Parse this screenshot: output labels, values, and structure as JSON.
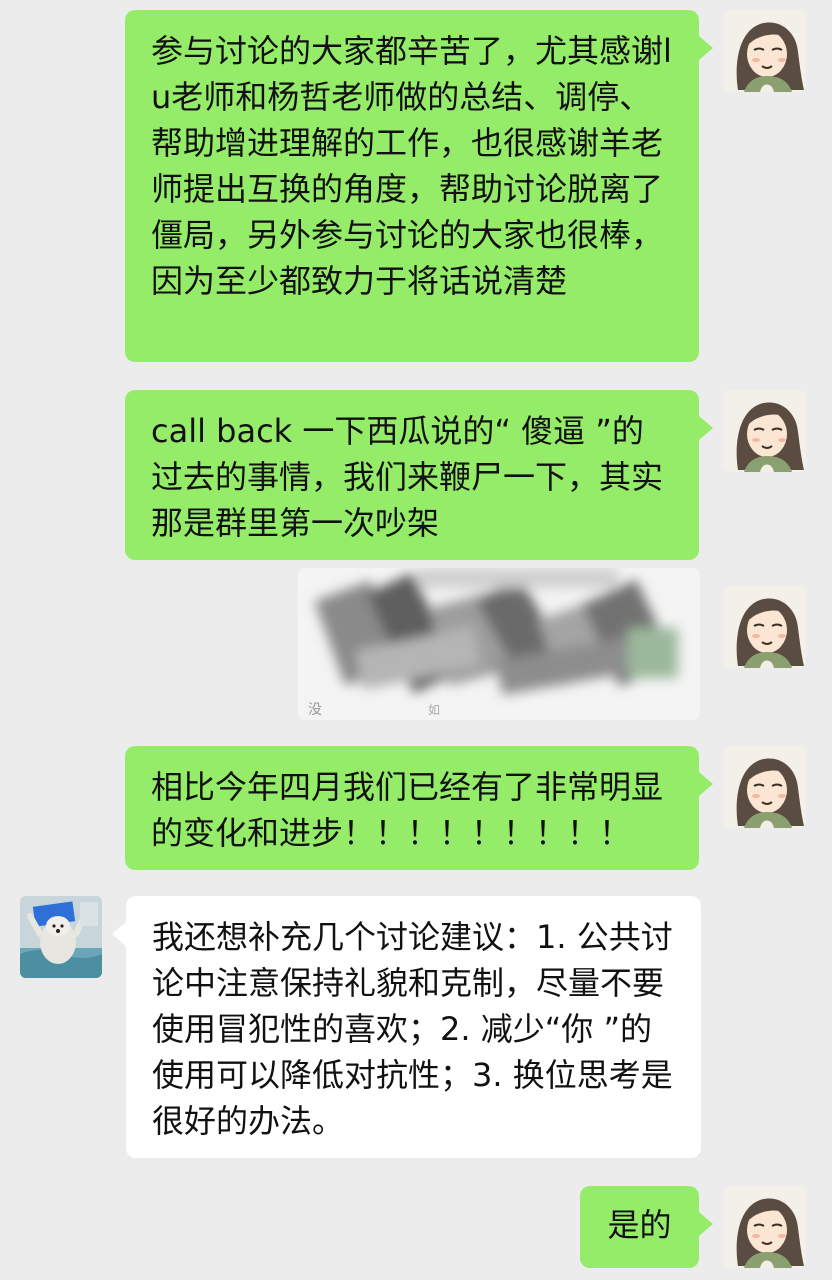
{
  "chat": {
    "messages": [
      {
        "sender": "self",
        "text": "参与讨论的大家都辛苦了，尤其感谢lu老师和杨哲老师做的总结、调停、帮助增进理解的工作，也很感谢羊老师提出互换的角度，帮助讨论脱离了僵局，另外参与讨论的大家也很棒，因为至少都致力于将话说清楚"
      },
      {
        "sender": "self",
        "text": "call back 一下西瓜说的“ 傻逼 ”的过去的事情，我们来鞭尸一下，其实那是群里第一次吵架"
      },
      {
        "sender": "self",
        "type": "image",
        "caption_fragments": [
          "没",
          "如"
        ]
      },
      {
        "sender": "self",
        "text": "相比今年四月我们已经有了非常明显的变化和进步！！！！！！！！！"
      },
      {
        "sender": "other",
        "text": "我还想补充几个讨论建议：1. 公共讨论中注意保持礼貌和克制，尽量不要使用冒犯性的喜欢；2. 减少“你 ”的使用可以降低对抗性；3. 换位思考是很好的办法。"
      },
      {
        "sender": "self",
        "text": "是的"
      }
    ]
  },
  "colors": {
    "background": "#ececec",
    "self_bubble": "#95ec69",
    "other_bubble": "#ffffff"
  }
}
